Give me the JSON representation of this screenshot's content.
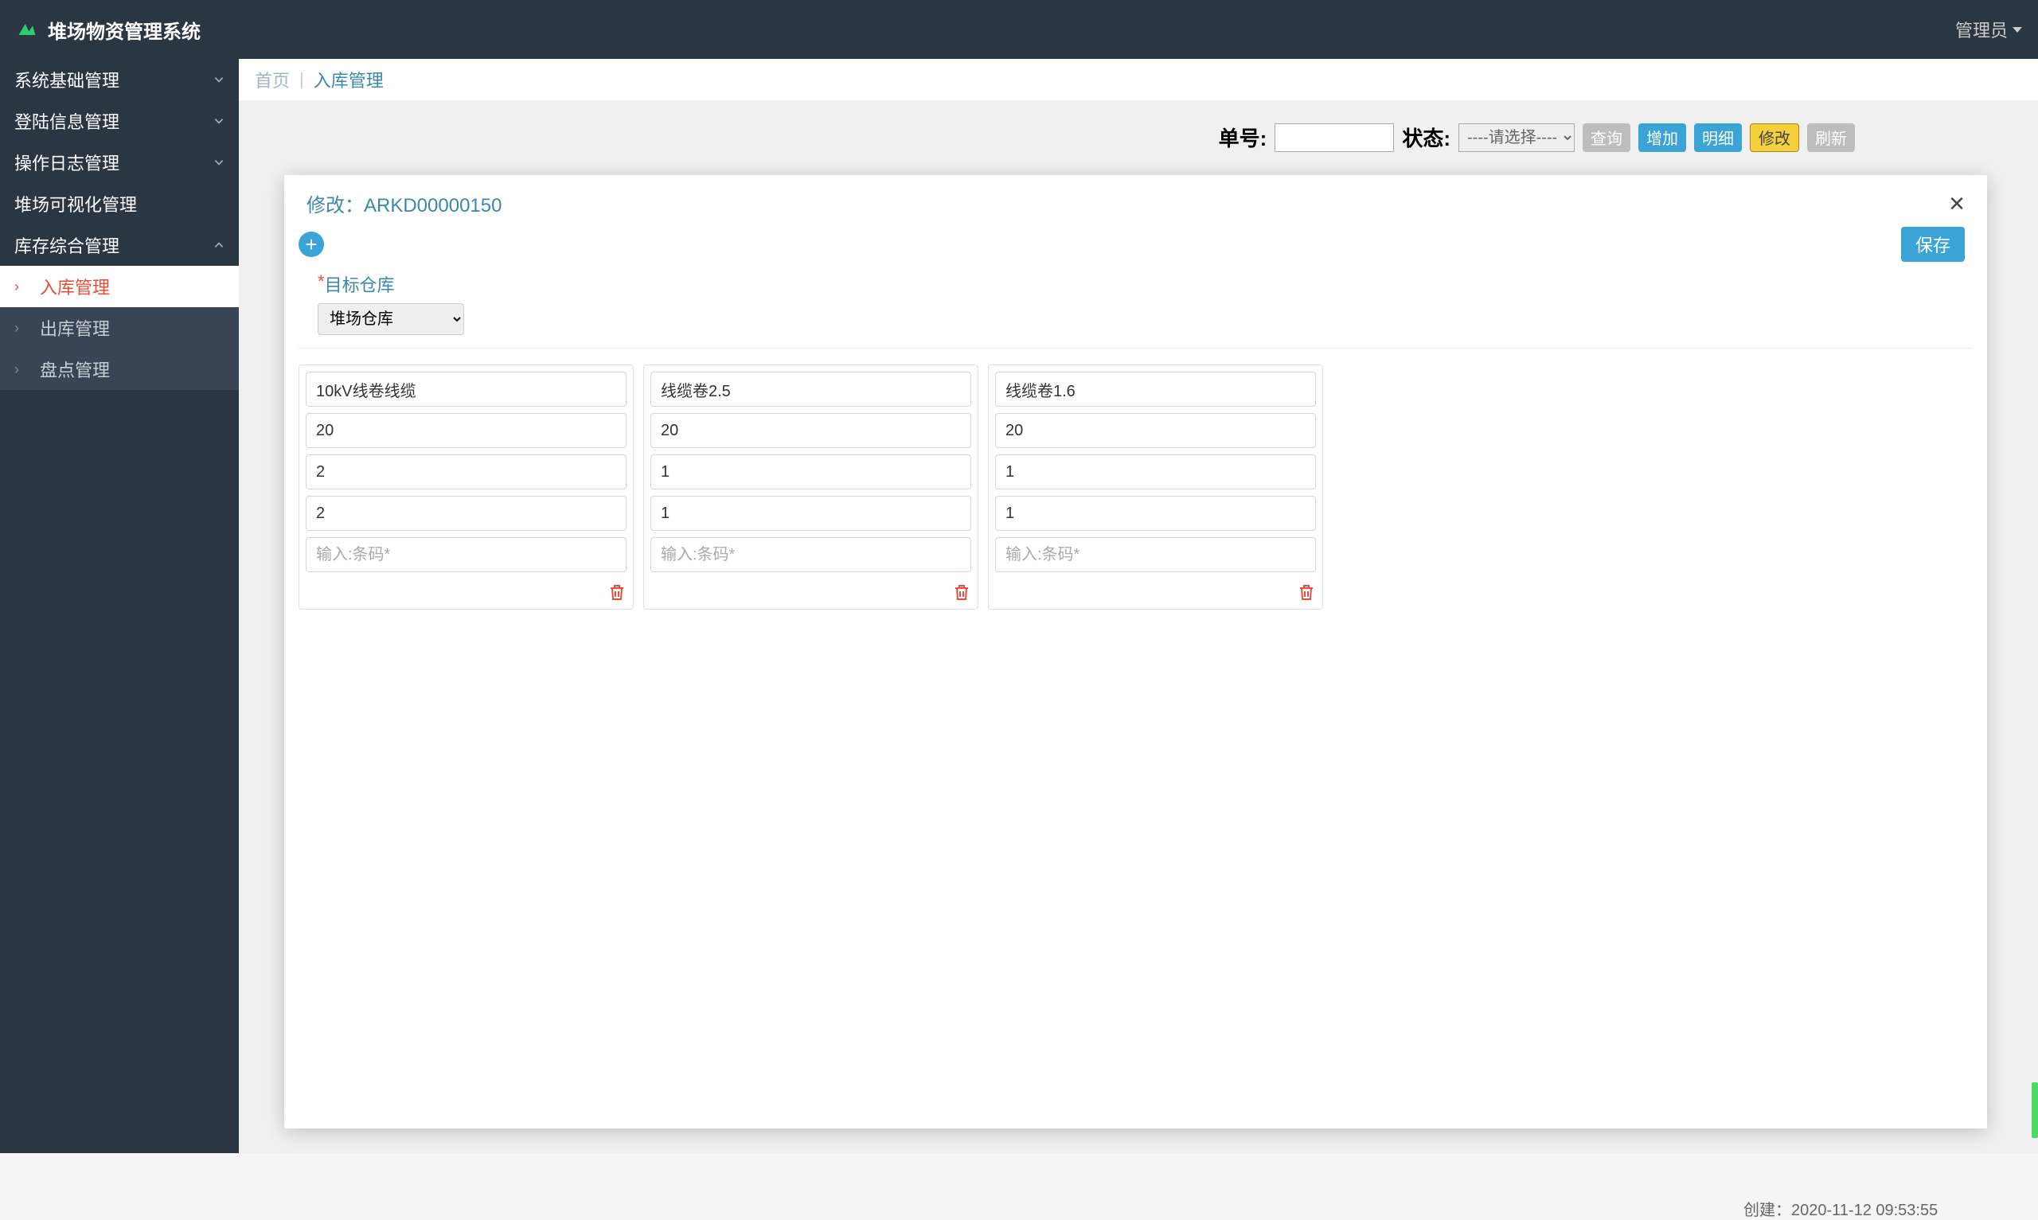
{
  "navbar": {
    "title": "堆场物资管理系统",
    "user_label": "管理员"
  },
  "sidebar": {
    "items": [
      {
        "label": "系统基础管理",
        "expanded": false
      },
      {
        "label": "登陆信息管理",
        "expanded": false
      },
      {
        "label": "操作日志管理",
        "expanded": false
      },
      {
        "label": "堆场可视化管理",
        "expanded": false
      },
      {
        "label": "库存综合管理",
        "expanded": true
      }
    ],
    "submenu": [
      {
        "label": "入库管理",
        "active": true
      },
      {
        "label": "出库管理",
        "active": false
      },
      {
        "label": "盘点管理",
        "active": false
      }
    ]
  },
  "breadcrumb": {
    "home": "首页",
    "current": "入库管理"
  },
  "toolbar": {
    "order_label": "单号:",
    "status_label": "状态:",
    "status_placeholder": "----请选择----",
    "btn_query": "查询",
    "btn_add": "增加",
    "btn_detail": "明细",
    "btn_edit": "修改",
    "btn_refresh": "刷新"
  },
  "modal": {
    "title_prefix": "修改：",
    "title_id": "ARKD00000150",
    "target_label": "目标仓库",
    "target_value": "堆场仓库",
    "save_btn": "保存",
    "barcode_placeholder": "输入:条码*",
    "cards": [
      {
        "name": "10kV线卷线缆",
        "f2": "20",
        "f3": "2",
        "f4": "2"
      },
      {
        "name": "线缆卷2.5",
        "f2": "20",
        "f3": "1",
        "f4": "1"
      },
      {
        "name": "线缆卷1.6",
        "f2": "20",
        "f3": "1",
        "f4": "1"
      }
    ]
  },
  "footer": {
    "created_at_label": "创建：",
    "created_at_value": "2020-11-12 09:53:55"
  }
}
